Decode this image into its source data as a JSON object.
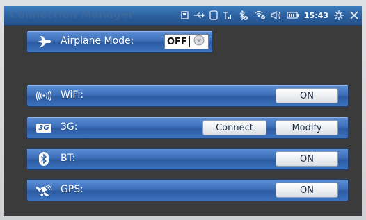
{
  "window": {
    "title": "Connection Manager"
  },
  "status_bar": {
    "time": "15:43",
    "icons": [
      "card-icon",
      "usb-icon",
      "sim-icon",
      "signal-icon",
      "bluetooth-off-icon",
      "wifi-off-icon",
      "volume-icon",
      "battery-icon",
      "settings-icon",
      "close-icon"
    ]
  },
  "airplane": {
    "label": "Airplane Mode:",
    "toggle_value": "OFF"
  },
  "rows": {
    "wifi": {
      "label": "WiFi:",
      "button": "ON"
    },
    "threeg": {
      "badge": "3G",
      "label": "3G:",
      "connect": "Connect",
      "modify": "Modify"
    },
    "bt": {
      "label": "BT:",
      "button": "ON"
    },
    "gps": {
      "label": "GPS:",
      "button": "ON"
    }
  },
  "colors": {
    "accent": "#3d6fb8",
    "titlebar": "#2c5f9e"
  }
}
